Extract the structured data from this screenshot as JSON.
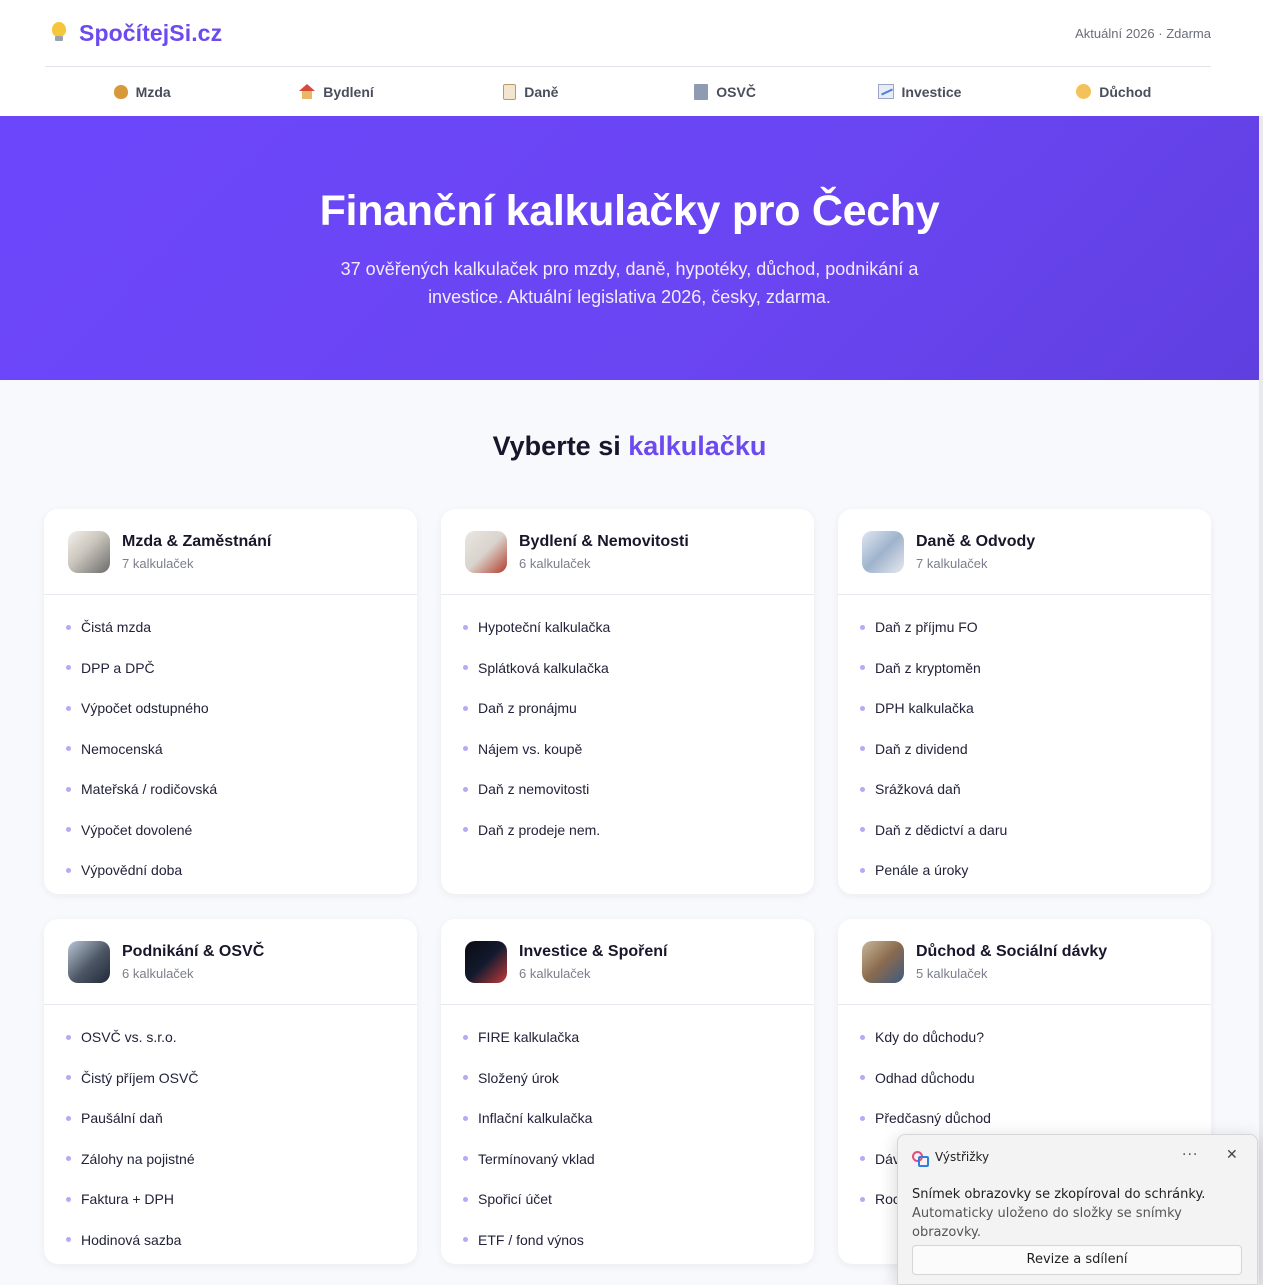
{
  "site": {
    "logo_text": "SpočítejSi.cz",
    "logo_icon": "lightbulb-icon",
    "meta": "Aktuální 2026 · Zdarma"
  },
  "nav": {
    "items": [
      {
        "label": "Mzda",
        "icon": "money-bag-icon"
      },
      {
        "label": "Bydlení",
        "icon": "house-icon"
      },
      {
        "label": "Daně",
        "icon": "clipboard-icon"
      },
      {
        "label": "OSVČ",
        "icon": "office-building-icon"
      },
      {
        "label": "Investice",
        "icon": "chart-increasing-icon"
      },
      {
        "label": "Důchod",
        "icon": "older-person-icon"
      }
    ]
  },
  "hero": {
    "title": "Finanční kalkulačky pro Čechy",
    "subtitle": "37 ověřených kalkulaček pro mzdy, daně, hypotéky, důchod, podnikání a investice. Aktuální legislativa 2026, česky, zdarma."
  },
  "section": {
    "title_prefix": "Vyberte si",
    "title_accent": "kalkulačku"
  },
  "cards": [
    {
      "title": "Mzda & Zaměstnání",
      "count": "7 kalkulaček",
      "items": [
        "Čistá mzda",
        "DPP a DPČ",
        "Výpočet odstupného",
        "Nemocenská",
        "Mateřská / rodičovská",
        "Výpočet dovolené",
        "Výpovědní doba"
      ]
    },
    {
      "title": "Bydlení & Nemovitosti",
      "count": "6 kalkulaček",
      "items": [
        "Hypoteční kalkulačka",
        "Splátková kalkulačka",
        "Daň z pronájmu",
        "Nájem vs. koupě",
        "Daň z nemovitosti",
        "Daň z prodeje nem."
      ]
    },
    {
      "title": "Daně & Odvody",
      "count": "7 kalkulaček",
      "items": [
        "Daň z příjmu FO",
        "Daň z kryptoměn",
        "DPH kalkulačka",
        "Daň z dividend",
        "Srážková daň",
        "Daň z dědictví a daru",
        "Penále a úroky"
      ]
    },
    {
      "title": "Podnikání & OSVČ",
      "count": "6 kalkulaček",
      "items": [
        "OSVČ vs. s.r.o.",
        "Čistý příjem OSVČ",
        "Paušální daň",
        "Zálohy na pojistné",
        "Faktura + DPH",
        "Hodinová sazba"
      ]
    },
    {
      "title": "Investice & Spoření",
      "count": "6 kalkulaček",
      "items": [
        "FIRE kalkulačka",
        "Složený úrok",
        "Inflační kalkulačka",
        "Termínovaný vklad",
        "Spořicí účet",
        "ETF / fond výnos"
      ]
    },
    {
      "title": "Důchod & Sociální dávky",
      "count": "5 kalkulaček",
      "items": [
        "Kdy do důchodu?",
        "Odhad důchodu",
        "Předčasný důchod",
        "Dáv",
        "Roc"
      ]
    }
  ],
  "toast": {
    "app_name": "Výstřižky",
    "more": "···",
    "close": "✕",
    "line1": "Snímek obrazovky se zkopíroval do schránky.",
    "line2": "Automaticky uloženo do složky se snímky obrazovky.",
    "button": "Revize a sdílení"
  }
}
